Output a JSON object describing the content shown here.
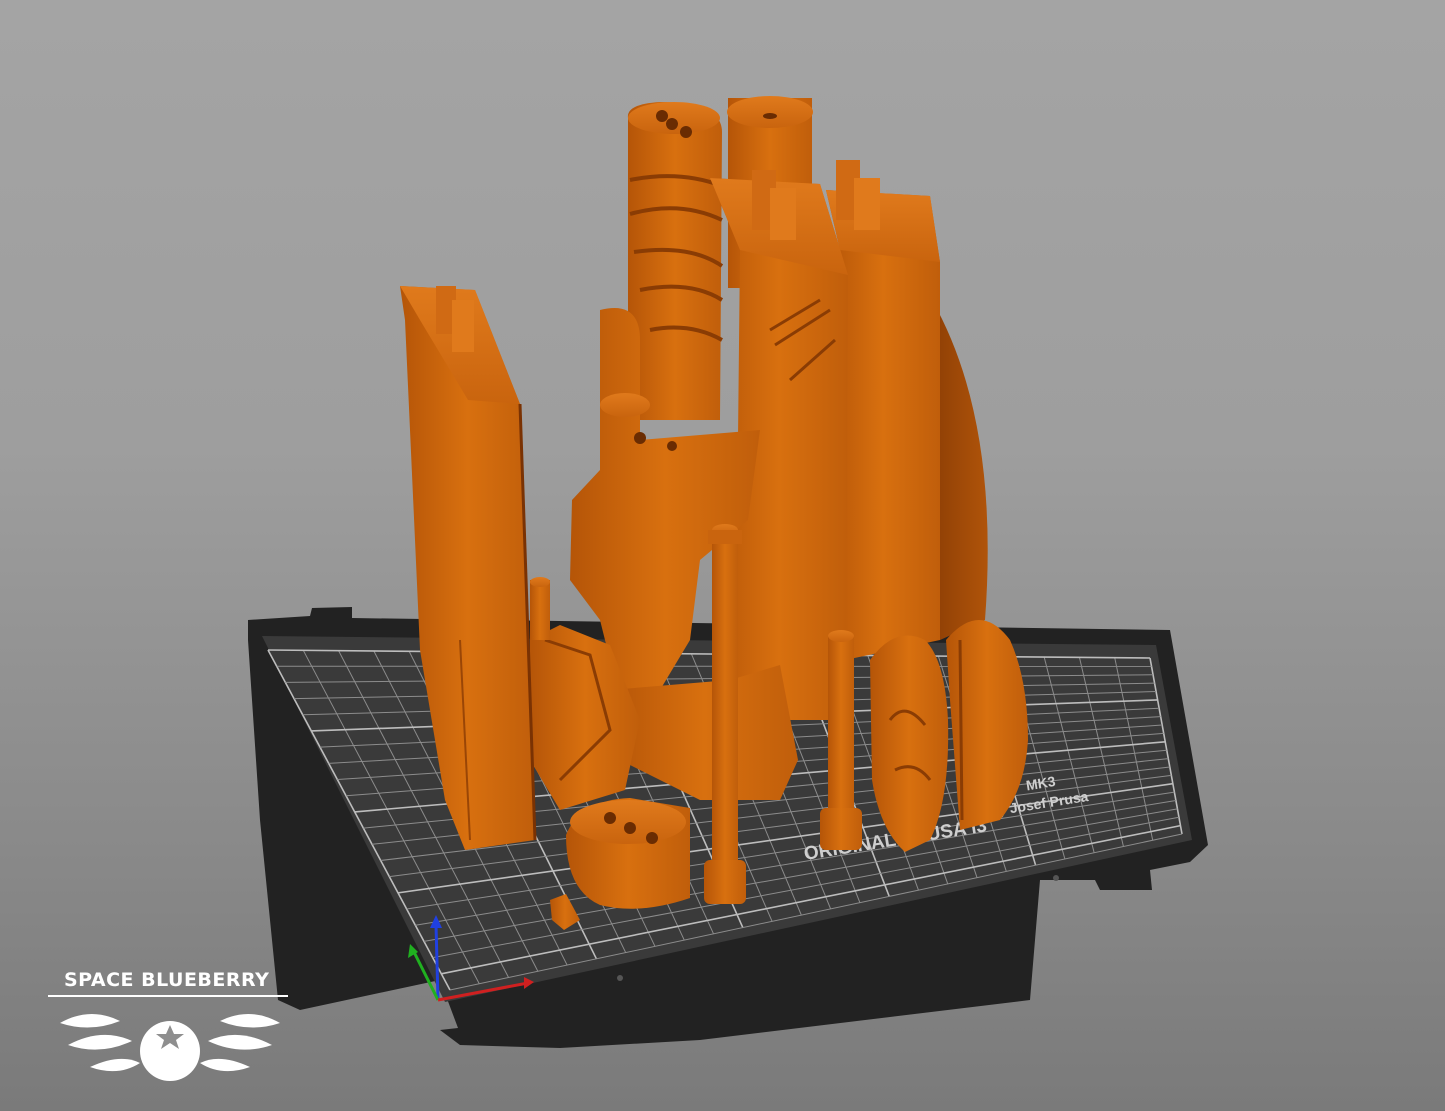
{
  "viewport": {
    "background_top": "#a4a4a4",
    "background_bottom": "#7a7a7a"
  },
  "bed": {
    "printer_label_left": "ORIGINAL PRUSA i3",
    "printer_label_model": "MK3",
    "printer_label_brand": "by Josef Prusa",
    "sheet_color": "#3b3b3b",
    "frame_color": "#1f1f1f",
    "grid_color": "#8a8a8a"
  },
  "model": {
    "color": "#d46a10",
    "parts": [
      "pillar-left",
      "tower-right",
      "column-ridged",
      "column-cap",
      "rock-pieces",
      "rod-tall",
      "rod-short",
      "skull-piece",
      "shield-piece",
      "disc-three-holes",
      "small-block"
    ]
  },
  "axes": {
    "x_color": "#d02020",
    "y_color": "#20b020",
    "z_color": "#2040e0"
  },
  "logo": {
    "title": "SPACE BLUEBERRY",
    "icon": "blueberry-wings-icon"
  }
}
